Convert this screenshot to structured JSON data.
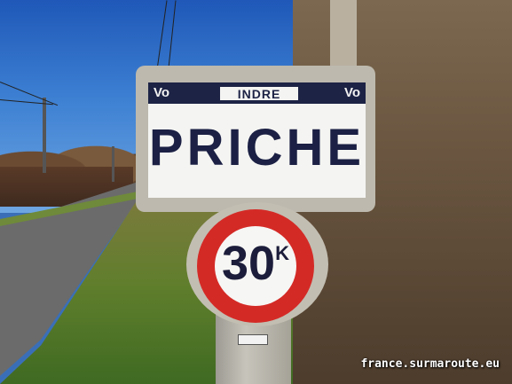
{
  "sign": {
    "band_left": "Vo",
    "band_right": "Vo",
    "department": "INDRE",
    "town": "PRICHE",
    "colors": {
      "plate": "#f4f4f2",
      "band": "#1d2345",
      "lettering": "#1b2044"
    }
  },
  "speed_limit": {
    "value": "30",
    "unit": "K",
    "colors": {
      "ring": "#d42a26",
      "center": "#f6f6f4"
    }
  },
  "watermark": "france.surmaroute.eu"
}
